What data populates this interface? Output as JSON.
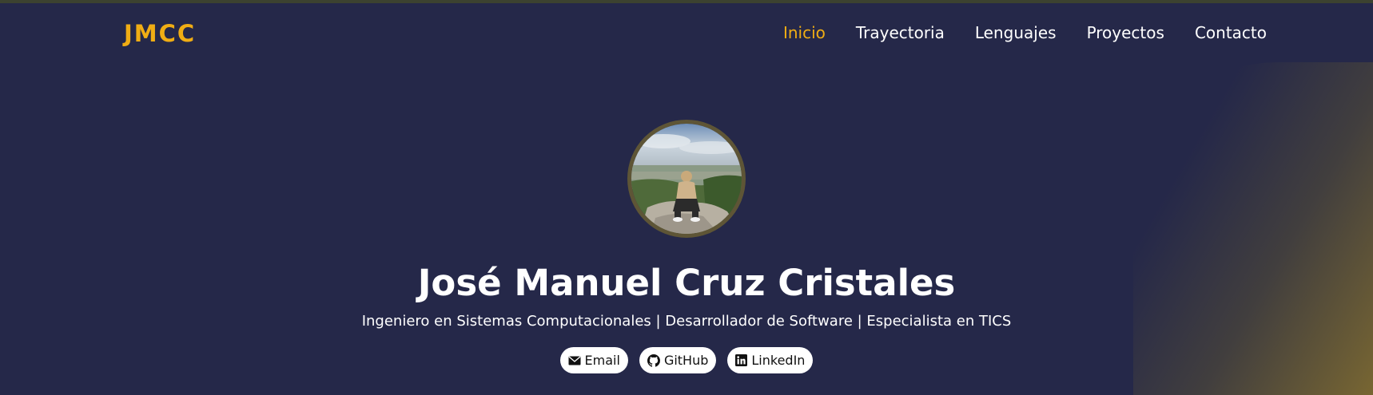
{
  "brand": {
    "logo": "JMCC",
    "accent": "#f0ad14"
  },
  "nav": {
    "items": [
      {
        "label": "Inicio",
        "active": true
      },
      {
        "label": "Trayectoria",
        "active": false
      },
      {
        "label": "Lenguajes",
        "active": false
      },
      {
        "label": "Proyectos",
        "active": false
      },
      {
        "label": "Contacto",
        "active": false
      }
    ]
  },
  "hero": {
    "avatar_icon": "profile-photo",
    "name": "José Manuel Cruz Cristales",
    "subtitle": "Ingeniero en Sistemas Computacionales | Desarrollador de Software | Especialista en TICS"
  },
  "socials": [
    {
      "label": "Email",
      "icon": "envelope-icon"
    },
    {
      "label": "GitHub",
      "icon": "github-icon"
    },
    {
      "label": "LinkedIn",
      "icon": "linkedin-icon"
    }
  ],
  "colors": {
    "background": "#252849",
    "text": "#ffffff"
  }
}
